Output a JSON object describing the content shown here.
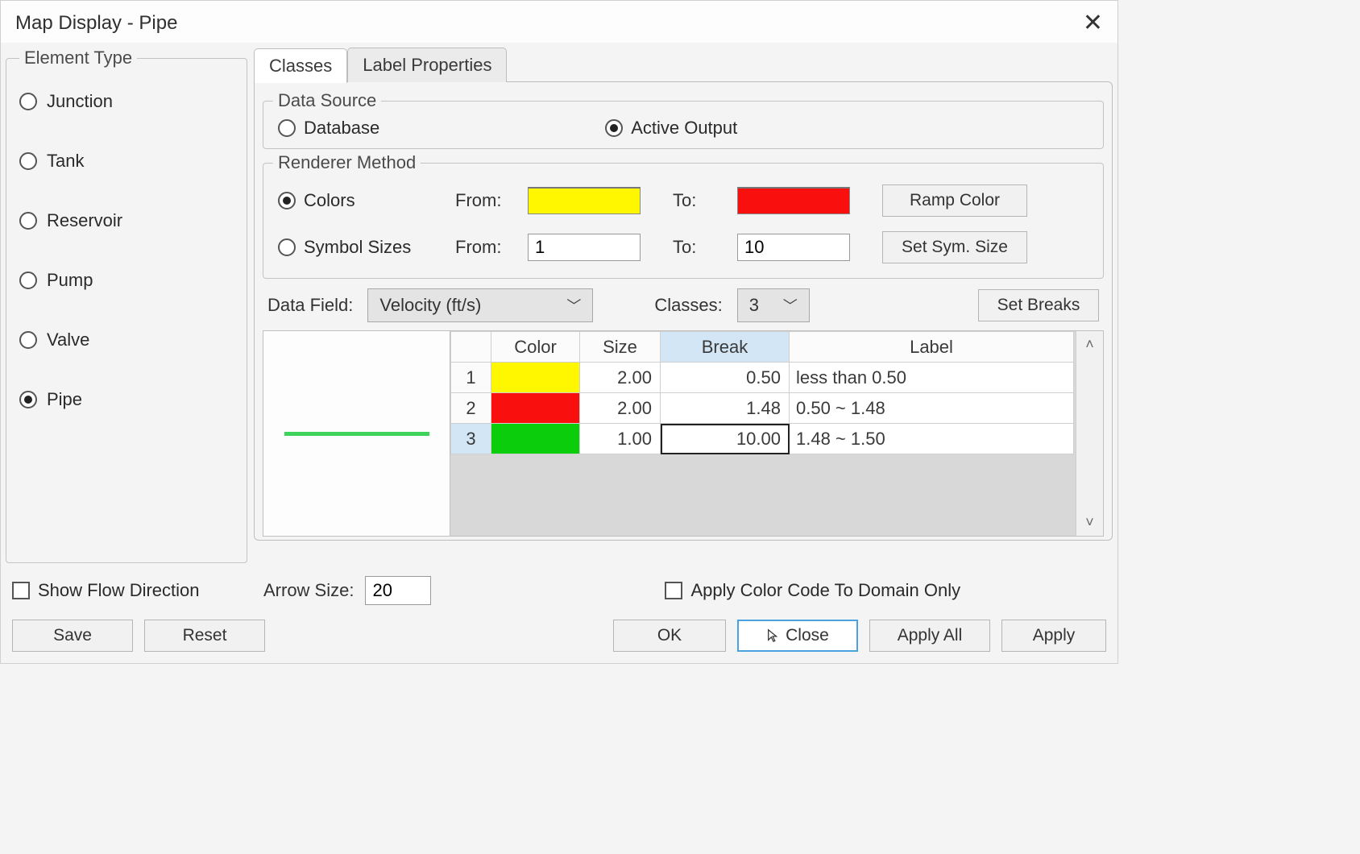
{
  "window": {
    "title": "Map Display  -  Pipe"
  },
  "element_type": {
    "legend": "Element Type",
    "options": [
      "Junction",
      "Tank",
      "Reservoir",
      "Pump",
      "Valve",
      "Pipe"
    ],
    "selected": "Pipe"
  },
  "tabs": {
    "classes": "Classes",
    "label_props": "Label Properties",
    "active": "Classes"
  },
  "data_source": {
    "legend": "Data Source",
    "database": "Database",
    "active_output": "Active Output",
    "selected": "Active Output"
  },
  "renderer": {
    "legend": "Renderer Method",
    "colors": "Colors",
    "symbol_sizes": "Symbol Sizes",
    "selected": "Colors",
    "from_label": "From:",
    "to_label": "To:",
    "color_from": "#fff700",
    "color_to": "#fa0f0f",
    "size_from": "1",
    "size_to": "10",
    "ramp_color": "Ramp Color",
    "set_sym_size": "Set Sym. Size"
  },
  "data_field": {
    "label": "Data Field:",
    "value": "Velocity (ft/s)",
    "classes_label": "Classes:",
    "classes_value": "3",
    "set_breaks": "Set Breaks"
  },
  "class_table": {
    "headers": {
      "color": "Color",
      "size": "Size",
      "break": "Break",
      "label": "Label"
    },
    "rows": [
      {
        "idx": "1",
        "color": "yellow",
        "size": "2.00",
        "break": "0.50",
        "label": "less than 0.50"
      },
      {
        "idx": "2",
        "color": "red",
        "size": "2.00",
        "break": "1.48",
        "label": "0.50 ~ 1.48"
      },
      {
        "idx": "3",
        "color": "green",
        "size": "1.00",
        "break": "10.00",
        "label": "1.48 ~ 1.50"
      }
    ],
    "selected_row": 3,
    "editing_cell": "break"
  },
  "show_flow_direction": "Show Flow Direction",
  "arrow_size": {
    "label": "Arrow Size:",
    "value": "20"
  },
  "apply_color_domain": "Apply Color Code To Domain Only",
  "buttons": {
    "save": "Save",
    "reset": "Reset",
    "ok": "OK",
    "close": "Close",
    "apply_all": "Apply All",
    "apply": "Apply"
  }
}
